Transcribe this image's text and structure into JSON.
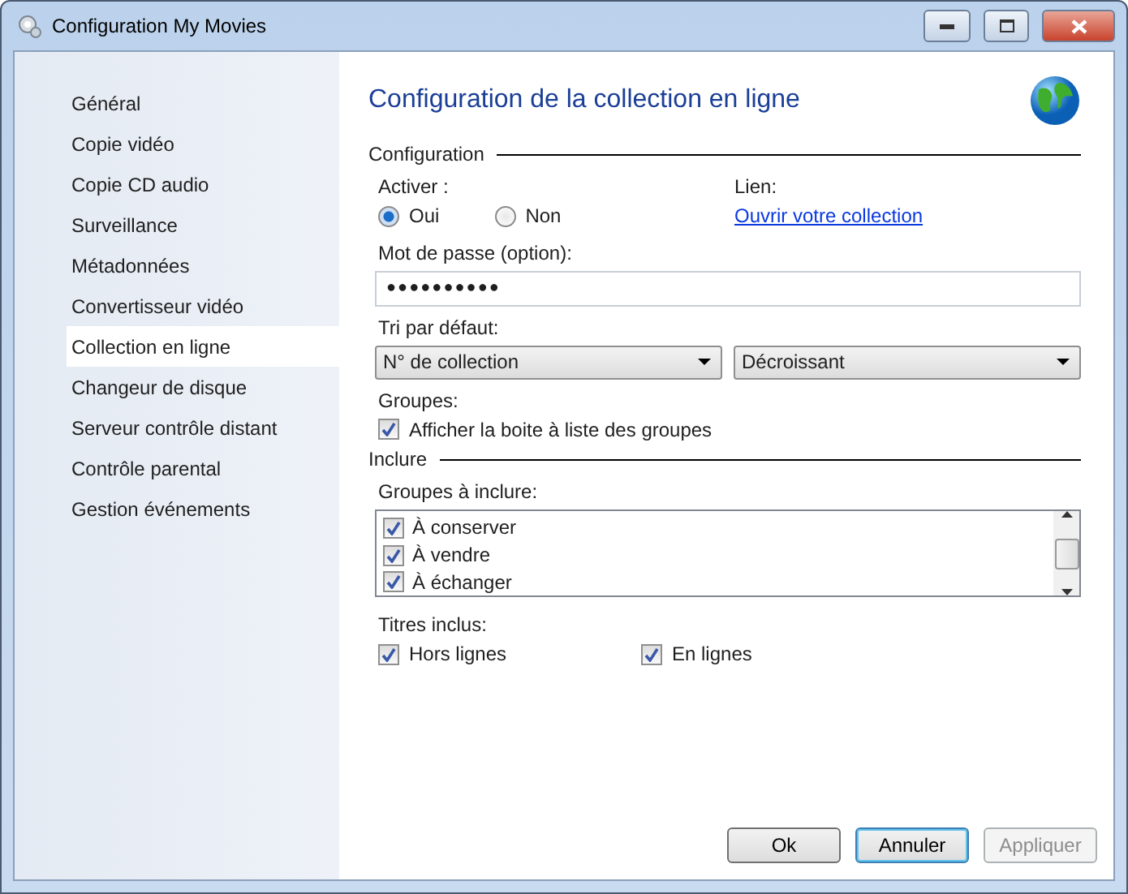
{
  "window": {
    "title": "Configuration My Movies"
  },
  "sidebar": {
    "items": [
      {
        "label": "Général",
        "selected": false
      },
      {
        "label": "Copie vidéo",
        "selected": false
      },
      {
        "label": "Copie CD audio",
        "selected": false
      },
      {
        "label": "Surveillance",
        "selected": false
      },
      {
        "label": "Métadonnées",
        "selected": false
      },
      {
        "label": "Convertisseur vidéo",
        "selected": false
      },
      {
        "label": "Collection en ligne",
        "selected": true
      },
      {
        "label": "Changeur de disque",
        "selected": false
      },
      {
        "label": "Serveur contrôle distant",
        "selected": false
      },
      {
        "label": "Contrôle parental",
        "selected": false
      },
      {
        "label": "Gestion événements",
        "selected": false
      }
    ]
  },
  "heading": "Configuration de la collection en ligne",
  "configuration": {
    "title": "Configuration",
    "activate_label": "Activer :",
    "radios": [
      {
        "label": "Oui",
        "selected": true
      },
      {
        "label": "Non",
        "selected": false
      }
    ],
    "link_label": "Lien:",
    "link": "Ouvrir votre collection",
    "password_label": "Mot de passe (option):",
    "password_value": "●●●●●●●●●●",
    "sort_label": "Tri par défaut:",
    "sort_field": "N° de collection",
    "sort_order": "Décroissant",
    "groups_label": "Groupes:",
    "show_groups": {
      "label": "Afficher la boite à liste des groupes",
      "checked": true
    }
  },
  "include": {
    "title": "Inclure",
    "groups_label": "Groupes à inclure:",
    "groups": [
      {
        "label": "À conserver",
        "checked": true
      },
      {
        "label": "À vendre",
        "checked": true
      },
      {
        "label": "À échanger",
        "checked": true
      }
    ],
    "titles_label": "Titres inclus:",
    "titles": [
      {
        "label": "Hors lignes",
        "checked": true
      },
      {
        "label": "En lignes",
        "checked": true
      }
    ]
  },
  "buttons": [
    {
      "label": "Ok",
      "focused": false,
      "disabled": false
    },
    {
      "label": "Annuler",
      "focused": true,
      "disabled": false
    },
    {
      "label": "Appliquer",
      "focused": false,
      "disabled": true
    }
  ]
}
